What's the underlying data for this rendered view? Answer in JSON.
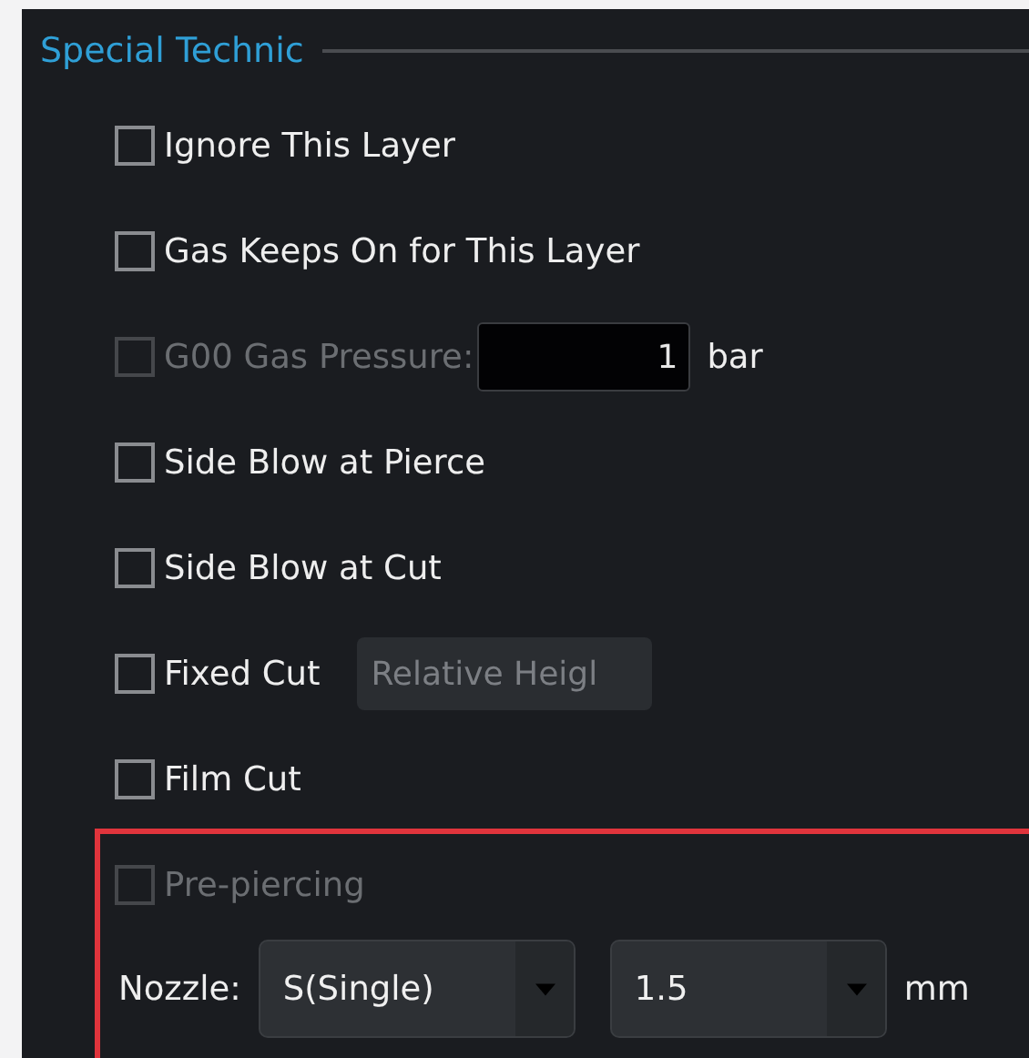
{
  "group": {
    "title": "Special Technic",
    "options": [
      {
        "kind": "checkbox",
        "label": "Ignore This Layer",
        "checked": false,
        "disabled": false
      },
      {
        "kind": "checkbox",
        "label": "Gas Keeps On for This Layer",
        "checked": false,
        "disabled": false
      },
      {
        "kind": "checkbox_field",
        "label": "G00 Gas Pressure:",
        "checked": false,
        "disabled": true,
        "value": "1",
        "unit": "bar"
      },
      {
        "kind": "checkbox",
        "label": "Side Blow at Pierce",
        "checked": false,
        "disabled": false
      },
      {
        "kind": "checkbox",
        "label": "Side Blow at Cut",
        "checked": false,
        "disabled": false
      },
      {
        "kind": "checkbox_select",
        "label": "Fixed Cut",
        "checked": false,
        "disabled": false,
        "select": {
          "value": "Relative Heigl",
          "disabled": true
        }
      },
      {
        "kind": "checkbox",
        "label": "Film Cut",
        "checked": false,
        "disabled": false
      }
    ],
    "highlighted_section": {
      "option": {
        "label": "Pre-piercing",
        "checked": false,
        "disabled": true
      },
      "nozzle": {
        "label": "Nozzle:",
        "type": {
          "value": "S(Single)"
        },
        "size": {
          "value": "1.5"
        },
        "unit": "mm"
      }
    }
  }
}
